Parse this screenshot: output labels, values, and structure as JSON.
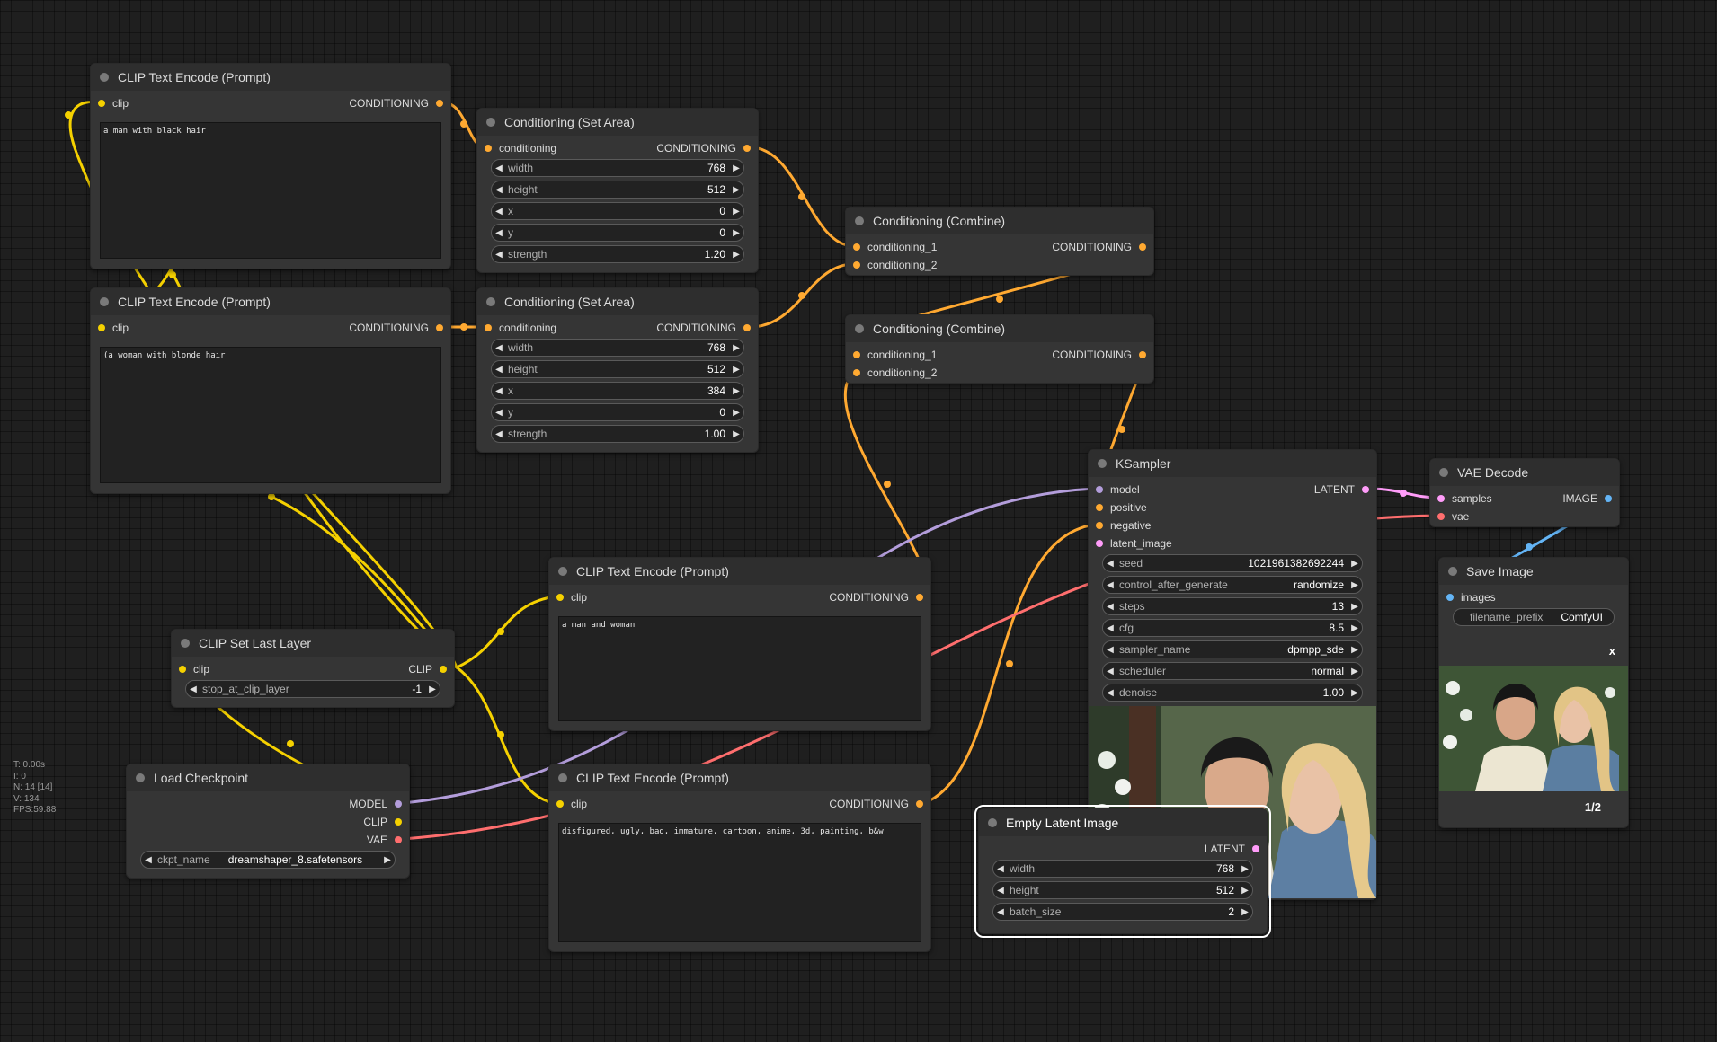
{
  "colors": {
    "clip": "#f5d100",
    "conditioning": "#ffa931",
    "model": "#b39ddb",
    "vae": "#ff6e6e",
    "latent": "#ff9cf9",
    "image": "#64b5f6"
  },
  "stats": {
    "t": "T: 0.00s",
    "i": "I: 0",
    "n": "N: 14 [14]",
    "v": "V: 134",
    "fps": "FPS:59.88"
  },
  "clip_top_black": {
    "title": "CLIP Text Encode (Prompt)",
    "input_clip": "clip",
    "output": "CONDITIONING",
    "text": "a man with black hair"
  },
  "clip_top_blonde": {
    "title": "CLIP Text Encode (Prompt)",
    "input_clip": "clip",
    "output": "CONDITIONING",
    "text": "(a woman with blonde hair"
  },
  "set_area_1": {
    "title": "Conditioning (Set Area)",
    "input": "conditioning",
    "output": "CONDITIONING",
    "widgets": [
      {
        "label": "width",
        "value": "768"
      },
      {
        "label": "height",
        "value": "512"
      },
      {
        "label": "x",
        "value": "0"
      },
      {
        "label": "y",
        "value": "0"
      },
      {
        "label": "strength",
        "value": "1.20"
      }
    ]
  },
  "set_area_2": {
    "title": "Conditioning (Set Area)",
    "input": "conditioning",
    "output": "CONDITIONING",
    "widgets": [
      {
        "label": "width",
        "value": "768"
      },
      {
        "label": "height",
        "value": "512"
      },
      {
        "label": "x",
        "value": "384"
      },
      {
        "label": "y",
        "value": "0"
      },
      {
        "label": "strength",
        "value": "1.00"
      }
    ]
  },
  "combine_1": {
    "title": "Conditioning (Combine)",
    "input1": "conditioning_1",
    "input2": "conditioning_2",
    "output": "CONDITIONING"
  },
  "combine_2": {
    "title": "Conditioning (Combine)",
    "input1": "conditioning_1",
    "input2": "conditioning_2",
    "output": "CONDITIONING"
  },
  "ksampler": {
    "title": "KSampler",
    "inputs": [
      "model",
      "positive",
      "negative",
      "latent_image"
    ],
    "output": "LATENT",
    "widgets": [
      {
        "label": "seed",
        "value": "1021961382692244"
      },
      {
        "label": "control_after_generate",
        "value": "randomize"
      },
      {
        "label": "steps",
        "value": "13"
      },
      {
        "label": "cfg",
        "value": "8.5"
      },
      {
        "label": "sampler_name",
        "value": "dpmpp_sde"
      },
      {
        "label": "scheduler",
        "value": "normal"
      },
      {
        "label": "denoise",
        "value": "1.00"
      }
    ]
  },
  "vae_decode": {
    "title": "VAE Decode",
    "input1": "samples",
    "input2": "vae",
    "output": "IMAGE"
  },
  "save_image": {
    "title": "Save Image",
    "input": "images",
    "widget": {
      "label": "filename_prefix",
      "value": "ComfyUI"
    },
    "close": "x",
    "pager": "1/2"
  },
  "clip_mid": {
    "title": "CLIP Text Encode (Prompt)",
    "input_clip": "clip",
    "output": "CONDITIONING",
    "text": "a man and woman"
  },
  "clip_neg": {
    "title": "CLIP Text Encode (Prompt)",
    "input_clip": "clip",
    "output": "CONDITIONING",
    "text": "disfigured, ugly, bad, immature, cartoon, anime, 3d, painting, b&w"
  },
  "clip_set_last": {
    "title": "CLIP Set Last Layer",
    "input": "clip",
    "output": "CLIP",
    "widget": {
      "label": "stop_at_clip_layer",
      "value": "-1"
    }
  },
  "load_checkpoint": {
    "title": "Load Checkpoint",
    "outputs": [
      "MODEL",
      "CLIP",
      "VAE"
    ],
    "widget": {
      "label": "ckpt_name",
      "value": "dreamshaper_8.safetensors"
    }
  },
  "empty_latent": {
    "title": "Empty Latent Image",
    "output": "LATENT",
    "widgets": [
      {
        "label": "width",
        "value": "768"
      },
      {
        "label": "height",
        "value": "512"
      },
      {
        "label": "batch_size",
        "value": "2"
      }
    ]
  }
}
